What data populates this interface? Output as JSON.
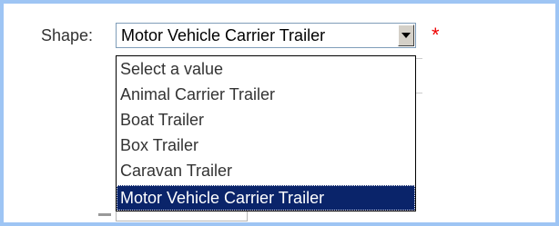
{
  "form": {
    "shape_label": "Shape:",
    "required_mark": "*"
  },
  "select": {
    "selected_value": "Motor Vehicle Carrier Trailer",
    "arrow_icon": "chevron-down-icon"
  },
  "dropdown": {
    "options": [
      "Select a value",
      "Animal Carrier Trailer",
      "Boat Trailer",
      "Box Trailer",
      "Caravan Trailer",
      "Motor Vehicle Carrier Trailer"
    ],
    "highlighted_option": "Motor Vehicle Carrier Trailer"
  },
  "colors": {
    "frame_border": "#9ec5f4",
    "selection_highlight": "#0a246a",
    "required_color": "#ee0000"
  }
}
